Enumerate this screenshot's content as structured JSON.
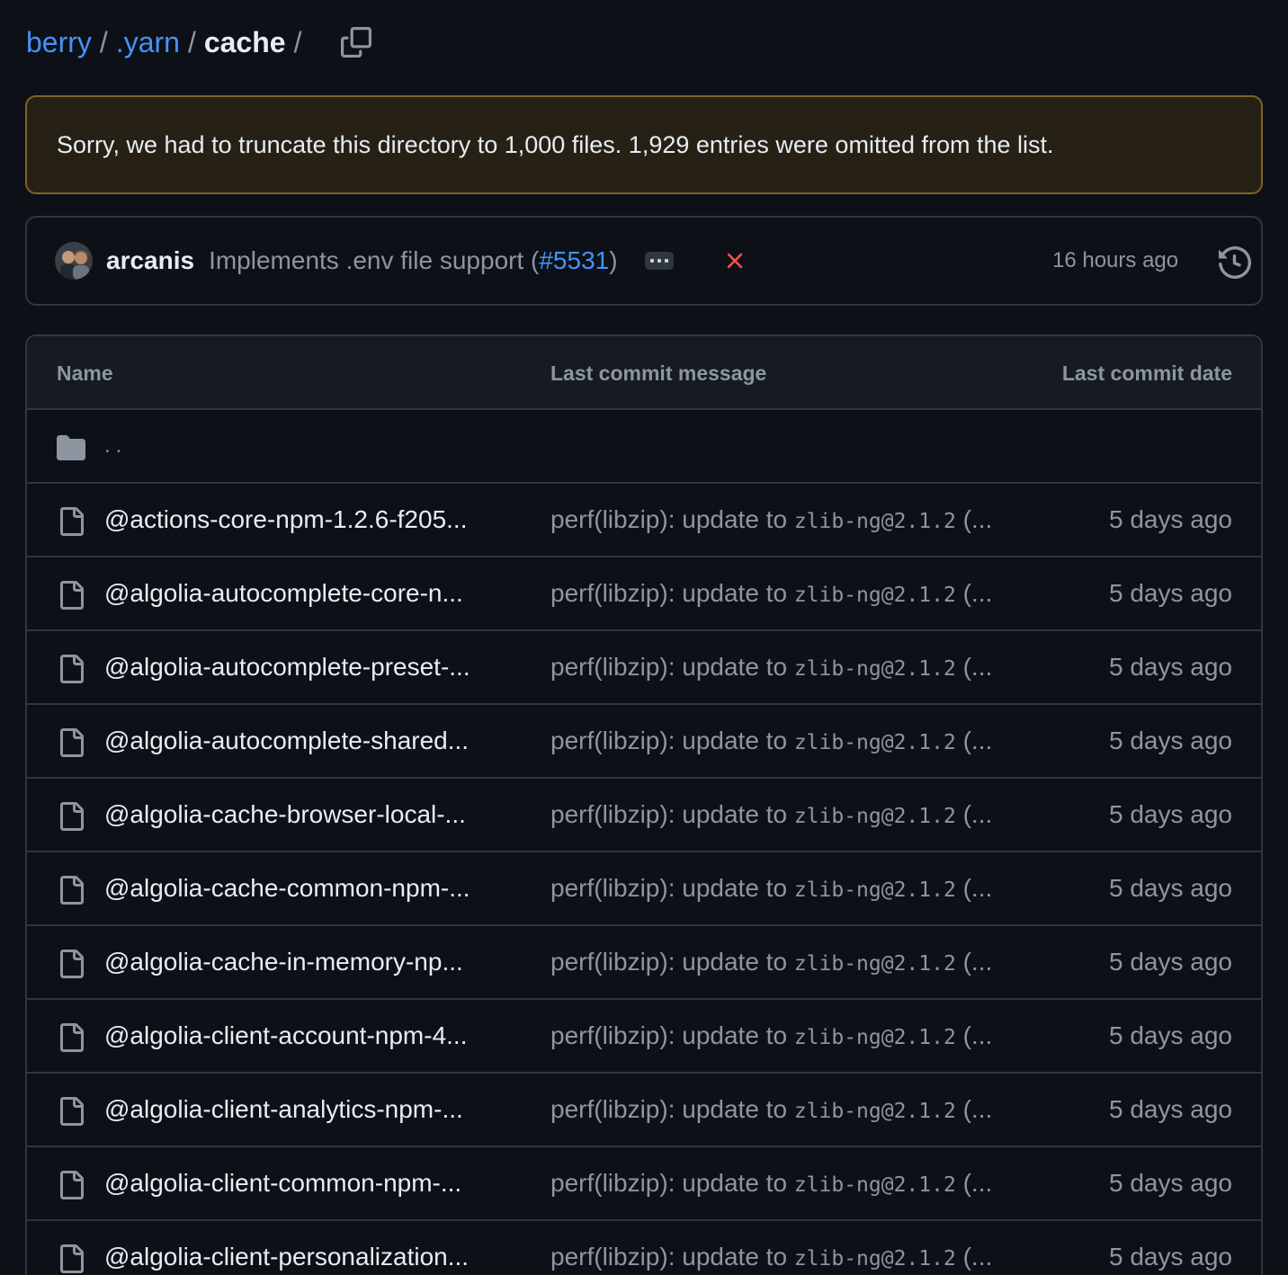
{
  "breadcrumb": {
    "items": [
      {
        "label": "berry"
      },
      {
        "label": ".yarn"
      }
    ],
    "current": "cache",
    "separator": "/",
    "copy_icon": "copy-icon"
  },
  "flash": {
    "message": "Sorry, we had to truncate this directory to 1,000 files. 1,929 entries were omitted from the list."
  },
  "latest_commit": {
    "author": "arcanis",
    "message_prefix": "Implements .env file support (",
    "pr_number": "#5531",
    "message_suffix": ")",
    "status_icon": "x-icon",
    "status_color": "#f85149",
    "time": "16 hours ago",
    "history_icon": "history-icon"
  },
  "table": {
    "headers": {
      "name": "Name",
      "message": "Last commit message",
      "date": "Last commit date"
    },
    "parent_dir": "..",
    "rows": [
      {
        "name": "@actions-core-npm-1.2.6-f205...",
        "message_text": "perf(libzip): update to ",
        "message_code": "zlib-ng@2.1.2",
        "message_tail": " (...",
        "date": "5 days ago"
      },
      {
        "name": "@algolia-autocomplete-core-n...",
        "message_text": "perf(libzip): update to ",
        "message_code": "zlib-ng@2.1.2",
        "message_tail": " (...",
        "date": "5 days ago"
      },
      {
        "name": "@algolia-autocomplete-preset-...",
        "message_text": "perf(libzip): update to ",
        "message_code": "zlib-ng@2.1.2",
        "message_tail": " (...",
        "date": "5 days ago"
      },
      {
        "name": "@algolia-autocomplete-shared...",
        "message_text": "perf(libzip): update to ",
        "message_code": "zlib-ng@2.1.2",
        "message_tail": " (...",
        "date": "5 days ago"
      },
      {
        "name": "@algolia-cache-browser-local-...",
        "message_text": "perf(libzip): update to ",
        "message_code": "zlib-ng@2.1.2",
        "message_tail": " (...",
        "date": "5 days ago"
      },
      {
        "name": "@algolia-cache-common-npm-...",
        "message_text": "perf(libzip): update to ",
        "message_code": "zlib-ng@2.1.2",
        "message_tail": " (...",
        "date": "5 days ago"
      },
      {
        "name": "@algolia-cache-in-memory-np...",
        "message_text": "perf(libzip): update to ",
        "message_code": "zlib-ng@2.1.2",
        "message_tail": " (...",
        "date": "5 days ago"
      },
      {
        "name": "@algolia-client-account-npm-4...",
        "message_text": "perf(libzip): update to ",
        "message_code": "zlib-ng@2.1.2",
        "message_tail": " (...",
        "date": "5 days ago"
      },
      {
        "name": "@algolia-client-analytics-npm-...",
        "message_text": "perf(libzip): update to ",
        "message_code": "zlib-ng@2.1.2",
        "message_tail": " (...",
        "date": "5 days ago"
      },
      {
        "name": "@algolia-client-common-npm-...",
        "message_text": "perf(libzip): update to ",
        "message_code": "zlib-ng@2.1.2",
        "message_tail": " (...",
        "date": "5 days ago"
      },
      {
        "name": "@algolia-client-personalization...",
        "message_text": "perf(libzip): update to ",
        "message_code": "zlib-ng@2.1.2",
        "message_tail": " (...",
        "date": "5 days ago"
      }
    ]
  },
  "colors": {
    "background": "#0d1117",
    "link": "#4493f8",
    "muted": "#8d96a0",
    "border": "#30363d",
    "flash_bg": "#272115",
    "flash_border": "#7d6325"
  }
}
